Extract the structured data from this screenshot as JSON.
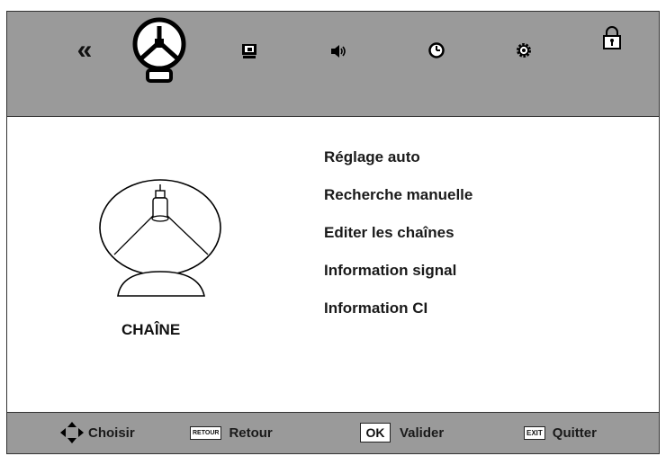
{
  "topbar": {
    "icons": [
      "back-double-arrow-icon",
      "channel-dish-icon",
      "picture-icon",
      "sound-icon",
      "time-icon",
      "setup-gear-icon",
      "lock-icon"
    ],
    "selected": "channel-dish-icon"
  },
  "menu": {
    "items": [
      "Réglage auto",
      "Recherche manuelle",
      "Editer les chaînes",
      "Information signal",
      "Information CI"
    ]
  },
  "section": {
    "label": "CHAÎNE"
  },
  "footer": {
    "choose_label": "Choisir",
    "back_key": "RETOUR",
    "back_label": "Retour",
    "ok_key": "OK",
    "ok_label": "Valider",
    "exit_key": "EXIT",
    "exit_label": "Quitter"
  },
  "colors": {
    "bar_background": "#9a9a9a",
    "content_background": "#ffffff",
    "text": "#1a1a1a"
  }
}
